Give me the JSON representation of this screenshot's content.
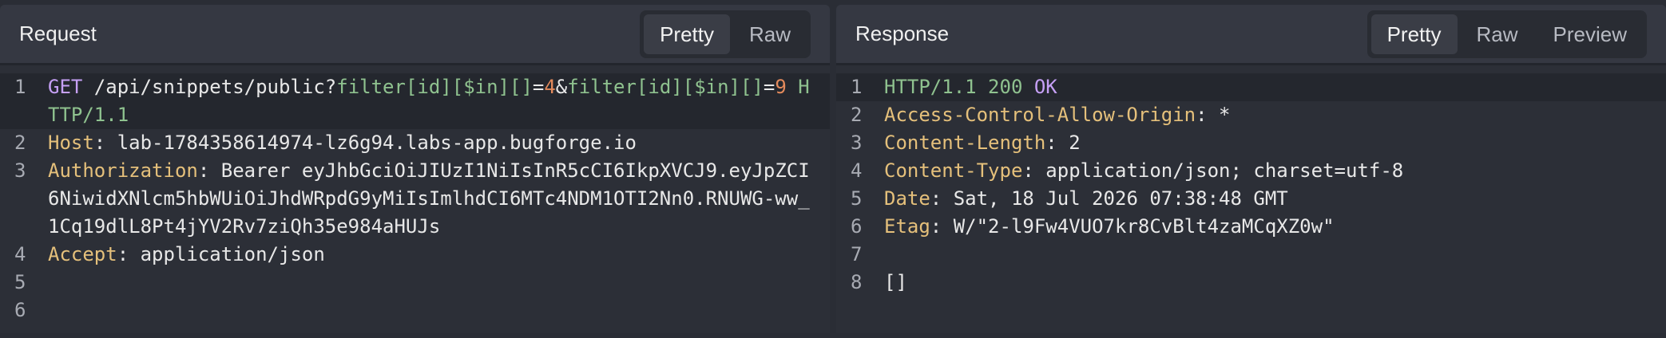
{
  "request": {
    "title": "Request",
    "tabs": [
      "Pretty",
      "Raw"
    ],
    "active_tab": "Pretty",
    "lines": [
      {
        "n": "1",
        "method": "GET",
        "path": " /api/snippets/public?",
        "q1": "filter[id][$in][]",
        "eq1": "=",
        "v1": "4",
        "amp": "&",
        "q2": "filter[id][$in][]",
        "eq2": "=",
        "v2": "9",
        "proto": " HTTP/1.1"
      },
      {
        "n": "2",
        "key": "Host",
        "sep": ": ",
        "val": "lab-1784358614974-lz6g94.labs-app.bugforge.io"
      },
      {
        "n": "3",
        "key": "Authorization",
        "sep": ": ",
        "val": "Bearer eyJhbGciOiJIUzI1NiIsInR5cCI6IkpXVCJ9.eyJpZCI6NiwidXNlcm5hbWUiOiJhdWRpdG9yMiIsImlhdCI6MTc4NDM1OTI2Nn0.RNUWG-ww_1Cq19dlL8Pt4jYV2Rv7ziQh35e984aHUJs"
      },
      {
        "n": "4",
        "key": "Accept",
        "sep": ": ",
        "val": "application/json"
      },
      {
        "n": "5"
      },
      {
        "n": "6"
      }
    ]
  },
  "response": {
    "title": "Response",
    "tabs": [
      "Pretty",
      "Raw",
      "Preview"
    ],
    "active_tab": "Pretty",
    "status": {
      "proto": "HTTP/1.1",
      "code": " 200",
      "text": " OK"
    },
    "lines": [
      {
        "n": "2",
        "key": "Access-Control-Allow-Origin",
        "sep": ": ",
        "val": "*"
      },
      {
        "n": "3",
        "key": "Content-Length",
        "sep": ": ",
        "val": "2"
      },
      {
        "n": "4",
        "key": "Content-Type",
        "sep": ": ",
        "val": "application/json; charset=utf-8"
      },
      {
        "n": "5",
        "key": "Date",
        "sep": ": ",
        "val": "Sat, 18 Jul 2026 07:38:48 GMT"
      },
      {
        "n": "6",
        "key": "Etag",
        "sep": ": ",
        "val": "W/\"2-l9Fw4VUO7kr8CvBlt4zaMCqXZ0w\""
      },
      {
        "n": "7"
      }
    ],
    "body_line": {
      "n": "8",
      "val": "[]"
    },
    "status_line_n": "1"
  },
  "colors": {
    "key": "#e5c07b",
    "method": "#c6a0f6",
    "green": "#8fc28f",
    "number": "#e38a5c"
  }
}
